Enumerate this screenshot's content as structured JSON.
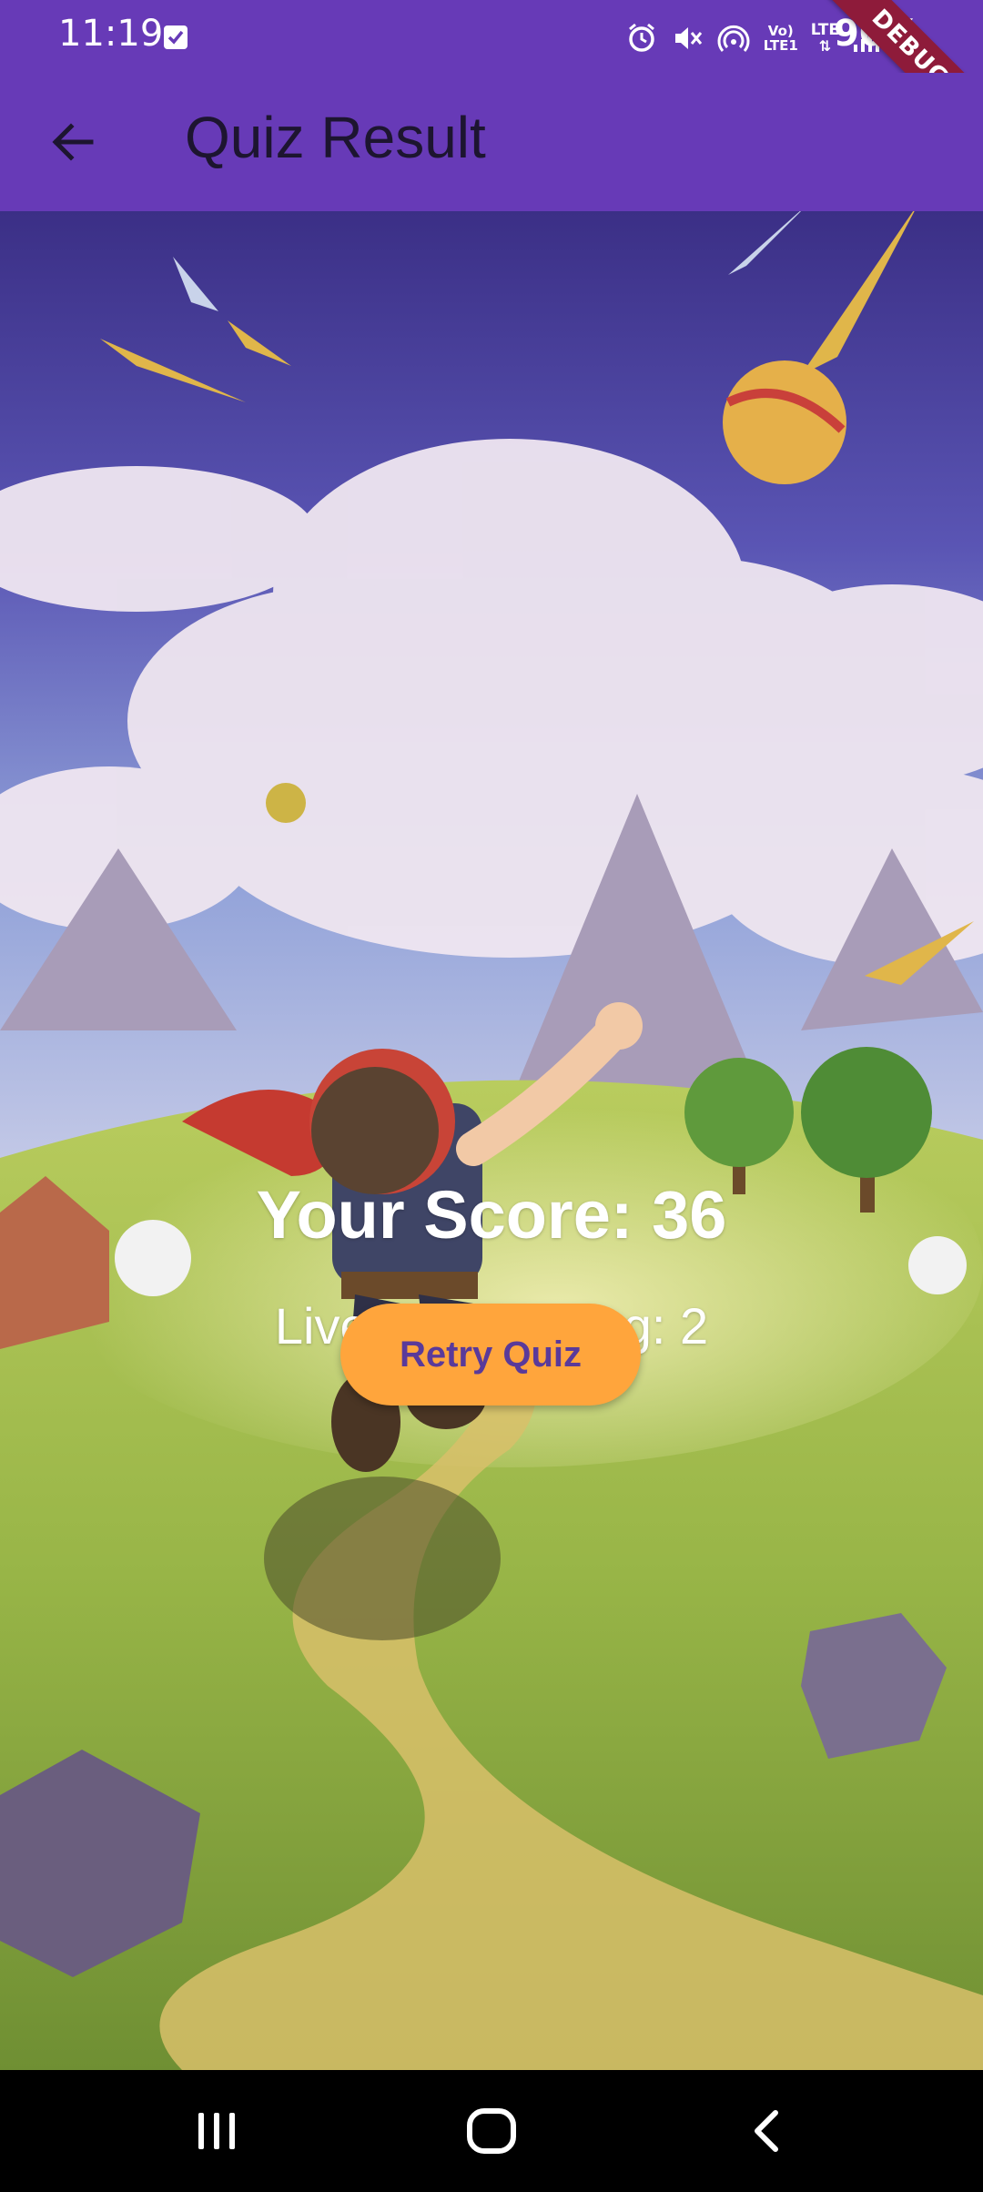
{
  "status_bar": {
    "time": "11:19",
    "battery": "90%",
    "debug_label": "DEBUG",
    "network_label_top": "Vo)",
    "network_label_bottom": "LTE1",
    "lte_label": "LTE"
  },
  "app_bar": {
    "title": "Quiz Result",
    "back_icon": "arrow-left-icon",
    "color": "#673ab7"
  },
  "result": {
    "score_label": "Your Score: 36",
    "lives_label": "Lives Remaining: 2",
    "retry_label": "Retry Quiz",
    "retry_color": "#ffa53c"
  },
  "nav_bar": {
    "recents_icon": "recents-icon",
    "home_icon": "home-icon",
    "back_icon": "back-chevron-icon"
  }
}
